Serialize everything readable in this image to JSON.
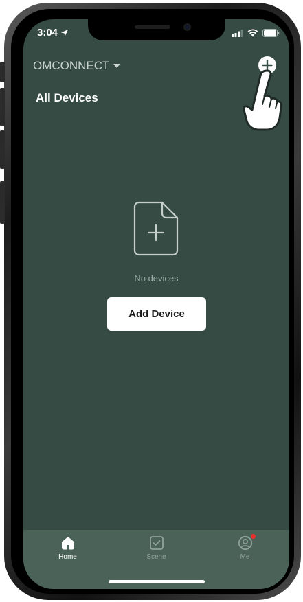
{
  "status_bar": {
    "time": "3:04"
  },
  "header": {
    "home_name": "OMCONNECT",
    "section_title": "All Devices"
  },
  "empty_state": {
    "message": "No devices",
    "add_button_label": "Add Device"
  },
  "tabbar": {
    "tabs": [
      {
        "label": "Home",
        "icon": "home-icon",
        "active": true
      },
      {
        "label": "Scene",
        "icon": "scene-icon",
        "active": false
      },
      {
        "label": "Me",
        "icon": "profile-icon",
        "active": false
      }
    ]
  },
  "colors": {
    "background": "#354b43",
    "tabbar": "#4b6259",
    "badge": "#e8312c"
  }
}
